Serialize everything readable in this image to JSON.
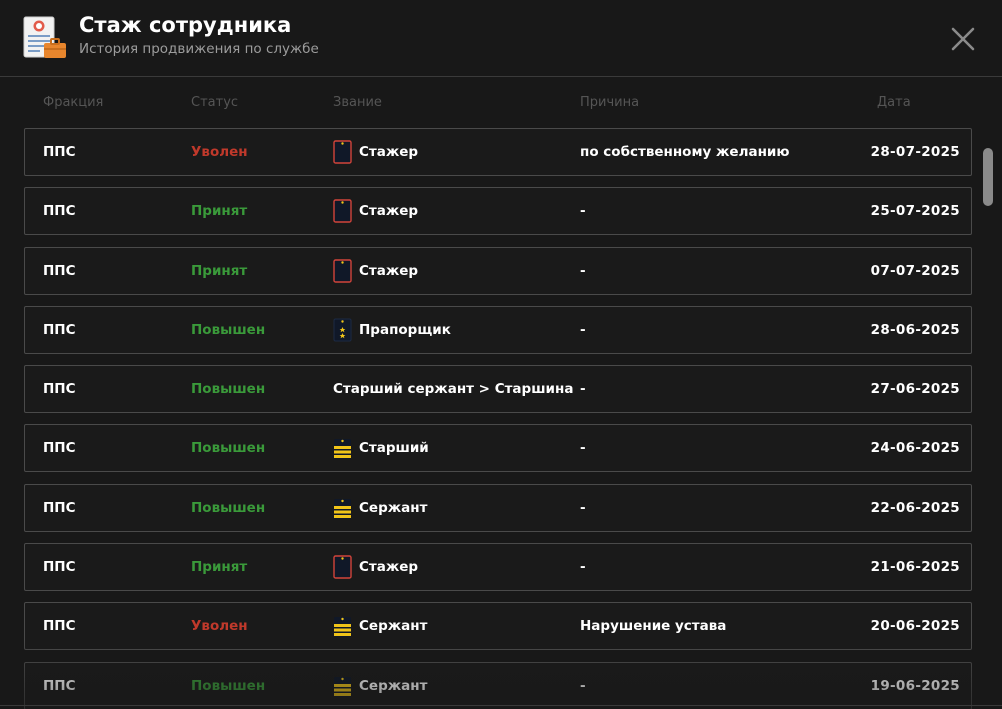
{
  "header": {
    "title": "Стаж сотрудника",
    "subtitle": "История продвижения по службе",
    "icon": "document-icon",
    "close_icon": "close-icon"
  },
  "columns": [
    "Фракция",
    "Статус",
    "Звание",
    "Причина",
    "Дата"
  ],
  "colors": {
    "background": "#181818",
    "row_border": "#4a4a4a",
    "status_fired": "#c0392b",
    "status_positive": "#3a9a3a",
    "header_muted": "#555555",
    "rank_gold": "#f0c419",
    "rank_navy": "#101828"
  },
  "rows": [
    {
      "faction": "ППС",
      "status": "Уволен",
      "status_type": "fired",
      "rank_icon": "trainee-epaulette",
      "rank": "Стажер",
      "reason": "по собственному желанию",
      "date": "28-07-2025"
    },
    {
      "faction": "ППС",
      "status": "Принят",
      "status_type": "positive",
      "rank_icon": "trainee-epaulette",
      "rank": "Стажер",
      "reason": "-",
      "date": "25-07-2025"
    },
    {
      "faction": "ППС",
      "status": "Принят",
      "status_type": "positive",
      "rank_icon": "trainee-epaulette",
      "rank": "Стажер",
      "reason": "-",
      "date": "07-07-2025"
    },
    {
      "faction": "ППС",
      "status": "Повышен",
      "status_type": "positive",
      "rank_icon": "ensign-epaulette",
      "rank": "Прапорщик",
      "reason": "-",
      "date": "28-06-2025"
    },
    {
      "faction": "ППС",
      "status": "Повышен",
      "status_type": "positive",
      "rank_icon": "",
      "rank": "Старший сержант > Старшина",
      "reason": "-",
      "date": "27-06-2025"
    },
    {
      "faction": "ППС",
      "status": "Повышен",
      "status_type": "positive",
      "rank_icon": "sergeant-epaulette",
      "rank": "Старший",
      "reason": "-",
      "date": "24-06-2025"
    },
    {
      "faction": "ППС",
      "status": "Повышен",
      "status_type": "positive",
      "rank_icon": "sergeant-epaulette",
      "rank": "Сержант",
      "reason": "-",
      "date": "22-06-2025"
    },
    {
      "faction": "ППС",
      "status": "Принят",
      "status_type": "positive",
      "rank_icon": "trainee-epaulette",
      "rank": "Стажер",
      "reason": "-",
      "date": "21-06-2025"
    },
    {
      "faction": "ППС",
      "status": "Уволен",
      "status_type": "fired",
      "rank_icon": "sergeant-epaulette",
      "rank": "Сержант",
      "reason": "Нарушение устава",
      "date": "20-06-2025"
    },
    {
      "faction": "ППС",
      "status": "Повышен",
      "status_type": "positive",
      "rank_icon": "sergeant-epaulette",
      "rank": "Сержант",
      "reason": "-",
      "date": "19-06-2025"
    }
  ]
}
